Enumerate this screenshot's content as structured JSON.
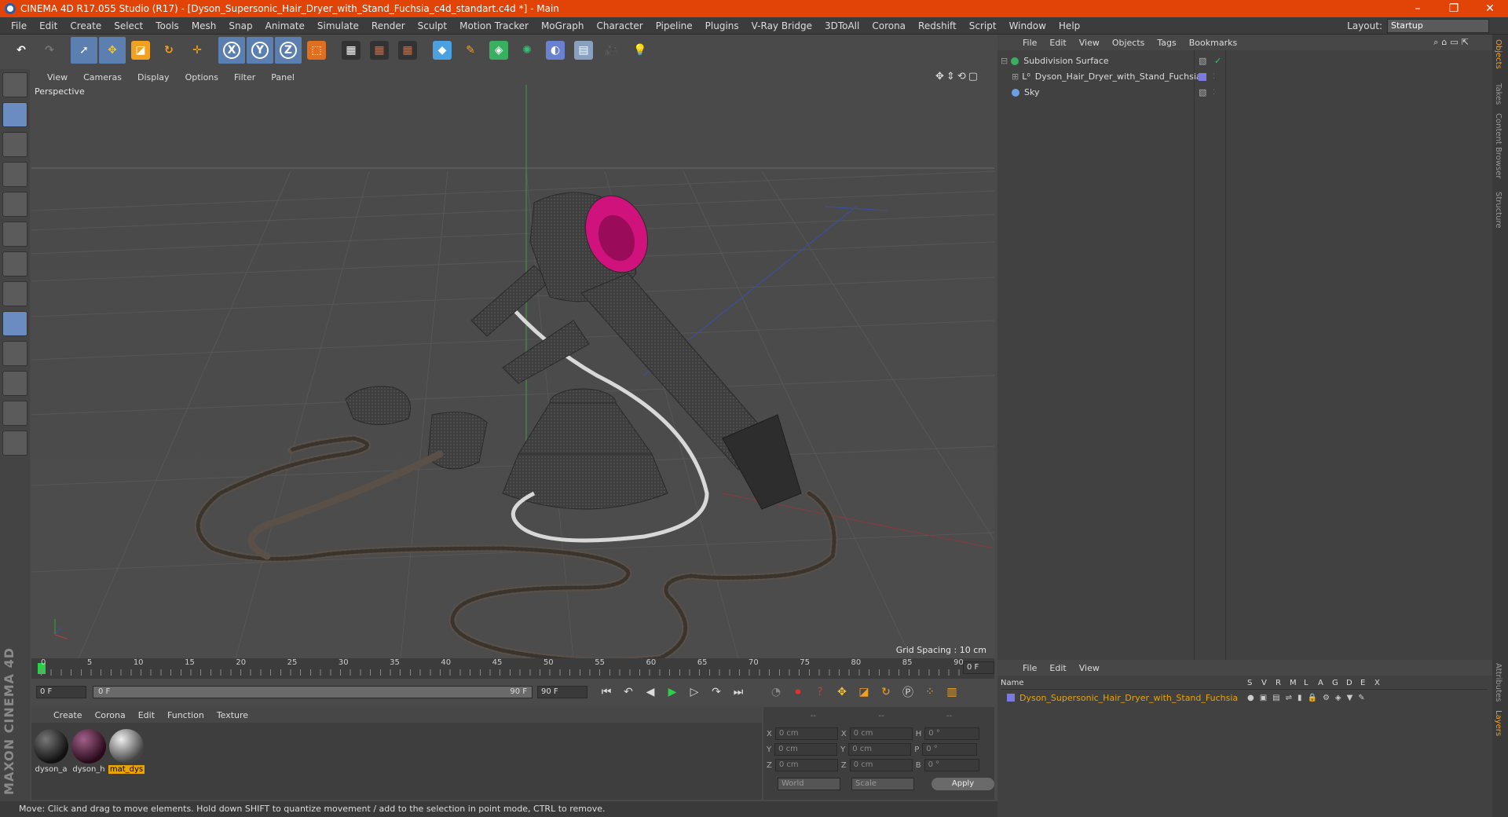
{
  "title": "CINEMA 4D R17.055 Studio (R17) - [Dyson_Supersonic_Hair_Dryer_with_Stand_Fuchsia_c4d_standart.c4d *] - Main",
  "menu": [
    "File",
    "Edit",
    "Create",
    "Select",
    "Tools",
    "Mesh",
    "Snap",
    "Animate",
    "Simulate",
    "Render",
    "Sculpt",
    "Motion Tracker",
    "MoGraph",
    "Character",
    "Pipeline",
    "Plugins",
    "V-Ray Bridge",
    "3DToAll",
    "Corona",
    "Redshift",
    "Script",
    "Window",
    "Help"
  ],
  "layout_label": "Layout:",
  "layout_value": "Startup",
  "viewport": {
    "menu": [
      "View",
      "Cameras",
      "Display",
      "Options",
      "Filter",
      "Panel"
    ],
    "label": "Perspective",
    "grid_spacing": "Grid Spacing : 10 cm"
  },
  "timeline": {
    "ticks": [
      "0",
      "5",
      "10",
      "15",
      "20",
      "25",
      "30",
      "35",
      "40",
      "45",
      "50",
      "55",
      "60",
      "65",
      "70",
      "75",
      "80",
      "85",
      "90"
    ],
    "current_frame": "0 F",
    "start_frame": "0 F",
    "range_start": "0 F",
    "range_end": "90 F",
    "end_frame": "90 F"
  },
  "materials": {
    "menu": [
      "Create",
      "Corona",
      "Edit",
      "Function",
      "Texture"
    ],
    "items": [
      {
        "name": "dyson_a"
      },
      {
        "name": "dyson_h"
      },
      {
        "name": "mat_dys"
      }
    ]
  },
  "coords": {
    "headers": [
      "--",
      "--",
      "--"
    ],
    "rows": [
      {
        "a": "X",
        "av": "0 cm",
        "b": "X",
        "bv": "0 cm",
        "c": "H",
        "cv": "0 °"
      },
      {
        "a": "Y",
        "av": "0 cm",
        "b": "Y",
        "bv": "0 cm",
        "c": "P",
        "cv": "0 °"
      },
      {
        "a": "Z",
        "av": "0 cm",
        "b": "Z",
        "bv": "0 cm",
        "c": "B",
        "cv": "0 °"
      }
    ],
    "world": "World",
    "scale": "Scale",
    "apply": "Apply"
  },
  "status": "Move: Click and drag to move elements. Hold down SHIFT to quantize movement / add to the selection in point mode, CTRL to remove.",
  "objects": {
    "menu": [
      "File",
      "Edit",
      "View",
      "Objects",
      "Tags",
      "Bookmarks"
    ],
    "items": [
      {
        "name": "Subdivision Surface"
      },
      {
        "name": "Dyson_Hair_Dryer_with_Stand_Fuchsia"
      },
      {
        "name": "Sky"
      }
    ]
  },
  "layers": {
    "menu": [
      "File",
      "Edit",
      "View"
    ],
    "columns": [
      "Name",
      "S",
      "V",
      "R",
      "M",
      "L",
      "A",
      "G",
      "D",
      "E",
      "X"
    ],
    "item": "Dyson_Supersonic_Hair_Dryer_with_Stand_Fuchsia"
  },
  "right_tabs": [
    "Objects",
    "Takes",
    "Content Browser",
    "Structure",
    "Attributes",
    "Layers"
  ],
  "brand": "MAXON CINEMA 4D",
  "colors": {
    "titlebar": "#e24307",
    "accent": "#5a7fb0",
    "fuchsia": "#d0127c",
    "layer_text": "#e8a400"
  }
}
